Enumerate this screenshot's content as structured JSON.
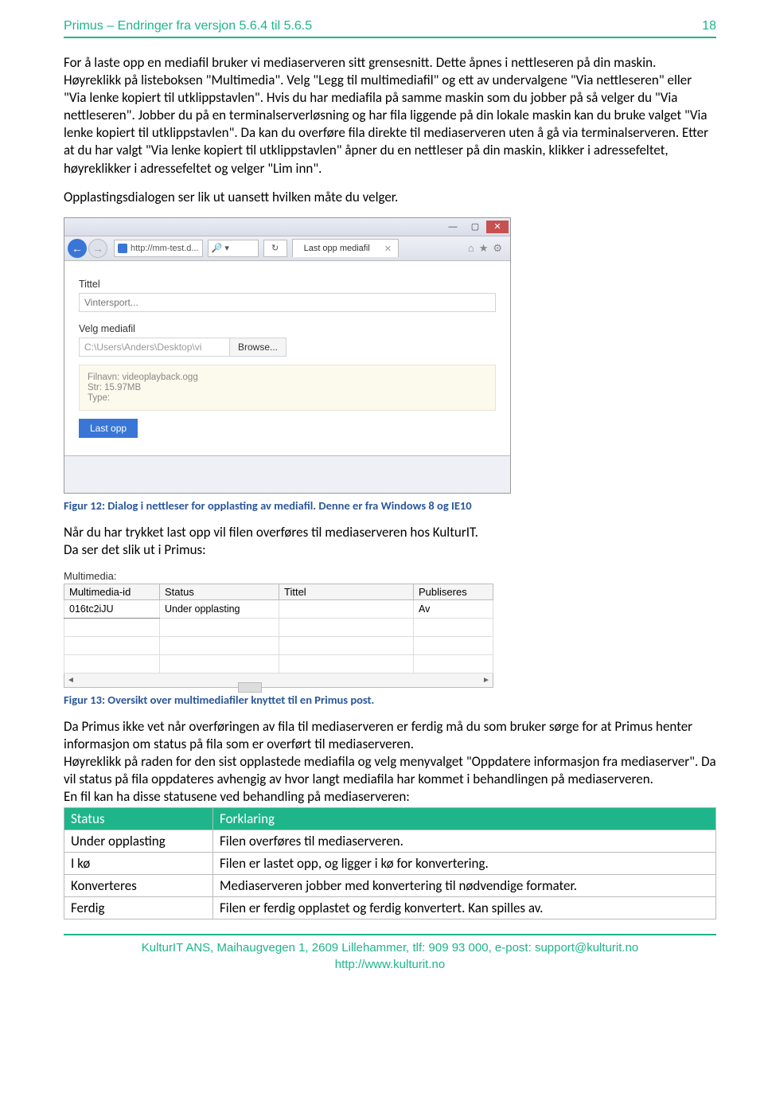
{
  "header": {
    "title": "Primus – Endringer fra versjon 5.6.4 til 5.6.5",
    "page": "18"
  },
  "para1": "For å laste opp en mediafil bruker vi mediaserveren sitt grensesnitt. Dette åpnes i nettleseren på din maskin. Høyreklikk på listeboksen \"Multimedia\". Velg \"Legg til multimediafil\" og ett av undervalgene \"Via nettleseren\" eller \"Via lenke kopiert til utklippstavlen\". Hvis du har mediafila på samme maskin som du jobber på så velger du \"Via nettleseren\". Jobber du på en terminalserverløsning og har fila liggende på din lokale maskin kan du bruke valget \"Via lenke kopiert til utklippstavlen\". Da kan du overføre fila direkte til mediaserveren uten å gå via terminalserveren. Etter at du har valgt \"Via lenke kopiert til utklippstavlen\" åpner du en nettleser på din maskin, klikker i adressefeltet, høyreklikker i adressefeltet og velger \"Lim inn\".",
  "para2": "Opplastingsdialogen ser lik ut uansett hvilken måte du velger.",
  "browser": {
    "url": "http://mm-test.d...",
    "search_hint": "🔎 ▾",
    "tab": "Last opp mediafil",
    "label_title": "Tittel",
    "title_placeholder": "Vintersport...",
    "label_file": "Velg mediafil",
    "path": "C:\\Users\\Anders\\Desktop\\vi",
    "browse": "Browse...",
    "filename_line": "Filnavn: videoplayback.ogg",
    "size_line": "Str: 15.97MB",
    "type_line": "Type:",
    "upload": "Last opp"
  },
  "fig12": "Figur 12: Dialog i nettleser for opplasting av mediafil. Denne er fra Windows 8 og IE10",
  "para3a": "Når du har trykket last opp vil filen overføres til mediaserveren hos KulturIT.",
  "para3b": "Da ser det slik ut i Primus:",
  "grid": {
    "title": "Multimedia:",
    "cols": [
      "Multimedia-id",
      "Status",
      "Tittel",
      "Publiseres"
    ],
    "id": "016tc2iJU",
    "status": "Under opplasting",
    "tittel": "",
    "pub": "Av"
  },
  "fig13": "Figur 13: Oversikt over multimediafiler knyttet til en Primus post.",
  "para4": "Da Primus ikke vet når overføringen av fila til mediaserveren er ferdig må du som bruker sørge for at Primus henter informasjon om status på fila som er overført til mediaserveren.",
  "para5": "Høyreklikk på raden for den sist opplastede mediafila og velg menyvalget \"Oppdatere informasjon fra mediaserver\". Da vil status på fila oppdateres avhengig av hvor langt mediafila har kommet i behandlingen på mediaserveren.",
  "para6": "En fil kan ha disse statusene ved behandling på mediaserveren:",
  "status_table": {
    "head": [
      "Status",
      "Forklaring"
    ],
    "rows": [
      [
        "Under opplasting",
        "Filen overføres til mediaserveren."
      ],
      [
        "I kø",
        "Filen er lastet opp, og ligger i kø for konvertering."
      ],
      [
        "Konverteres",
        "Mediaserveren jobber med konvertering til nødvendige formater."
      ],
      [
        "Ferdig",
        "Filen er ferdig opplastet og ferdig konvertert. Kan spilles av."
      ]
    ]
  },
  "footer": {
    "line1": "KulturIT ANS, Maihaugvegen 1, 2609 Lillehammer, tlf: 909 93 000, e-post: ",
    "email": "support@kulturit.no",
    "line2": "http://www.kulturit.no"
  }
}
